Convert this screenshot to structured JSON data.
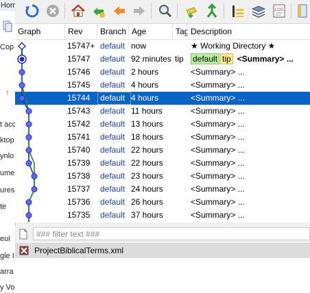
{
  "explorer_fragments": {
    "home_tab": "Hom",
    "copy_label": "Cop",
    "items": [
      "t acc",
      "ktop",
      "ynlo",
      "ume",
      "ures",
      "te",
      "eui",
      "gle I",
      "arra",
      "y Vol"
    ]
  },
  "toolbar": {
    "buttons": [
      {
        "name": "refresh",
        "icon": "refresh-icon"
      },
      {
        "name": "stop",
        "icon": "stop-icon"
      },
      {
        "name": "home",
        "icon": "home-icon"
      },
      {
        "name": "pull",
        "icon": "pull-icon"
      },
      {
        "name": "back",
        "icon": "back-arrow-icon"
      },
      {
        "name": "forward",
        "icon": "forward-arrow-icon"
      },
      {
        "name": "search",
        "icon": "search-icon"
      },
      {
        "name": "update",
        "icon": "update-icon"
      },
      {
        "name": "merge",
        "icon": "merge-icon"
      },
      {
        "name": "columns",
        "icon": "columns-icon"
      },
      {
        "name": "layers",
        "icon": "layers-icon"
      },
      {
        "name": "log",
        "icon": "log-icon",
        "label": "LOG"
      }
    ]
  },
  "columns": {
    "graph": "Graph",
    "rev": "Rev",
    "branch": "Branch",
    "age": "Age",
    "tag": "Tag",
    "description": "Description"
  },
  "rows": [
    {
      "rev": "15747+",
      "branch": "default",
      "age": "now",
      "tag": "",
      "desc": "★ Working Directory ★",
      "type": "wd"
    },
    {
      "rev": "15747",
      "branch": "default",
      "age": "92 minutes",
      "tag": "tip",
      "desc": "<Summary> ...",
      "tag_default": "default",
      "tag_tip": "tip",
      "type": "tip"
    },
    {
      "rev": "15746",
      "branch": "default",
      "age": "2 hours",
      "tag": "",
      "desc": "<Summary> ..."
    },
    {
      "rev": "15745",
      "branch": "default",
      "age": "4 hours",
      "tag": "",
      "desc": "<Summary> ..."
    },
    {
      "rev": "15744",
      "branch": "default",
      "age": "4 hours",
      "tag": "",
      "desc": "<Summary> ...",
      "selected": true
    },
    {
      "rev": "15743",
      "branch": "default",
      "age": "11 hours",
      "tag": "",
      "desc": "<Summary> ..."
    },
    {
      "rev": "15742",
      "branch": "default",
      "age": "13 hours",
      "tag": "",
      "desc": "<Summary> ..."
    },
    {
      "rev": "15741",
      "branch": "default",
      "age": "18 hours",
      "tag": "",
      "desc": "<Summary> ..."
    },
    {
      "rev": "15740",
      "branch": "default",
      "age": "22 hours",
      "tag": "",
      "desc": "<Summary> ..."
    },
    {
      "rev": "15739",
      "branch": "default",
      "age": "22 hours",
      "tag": "",
      "desc": "<Summary> ..."
    },
    {
      "rev": "15738",
      "branch": "default",
      "age": "23 hours",
      "tag": "",
      "desc": "<Summary> ..."
    },
    {
      "rev": "15737",
      "branch": "default",
      "age": "24 hours",
      "tag": "",
      "desc": "<Summary> ..."
    },
    {
      "rev": "15736",
      "branch": "default",
      "age": "26 hours",
      "tag": "",
      "desc": "<Summary> ..."
    },
    {
      "rev": "15735",
      "branch": "default",
      "age": "37 hours",
      "tag": "",
      "desc": "<Summary> ..."
    }
  ],
  "filter": {
    "placeholder": "### filter text ###",
    "value": ""
  },
  "files": [
    {
      "name": "ProjectBiblicalTerms.xml",
      "status_icon": "modified-file-icon"
    }
  ],
  "colors": {
    "selection": "#0a64c8",
    "branch_text": "#1a3fb0",
    "graph_main": "#1a2bd0",
    "graph_branch": "#1f8a2a"
  }
}
